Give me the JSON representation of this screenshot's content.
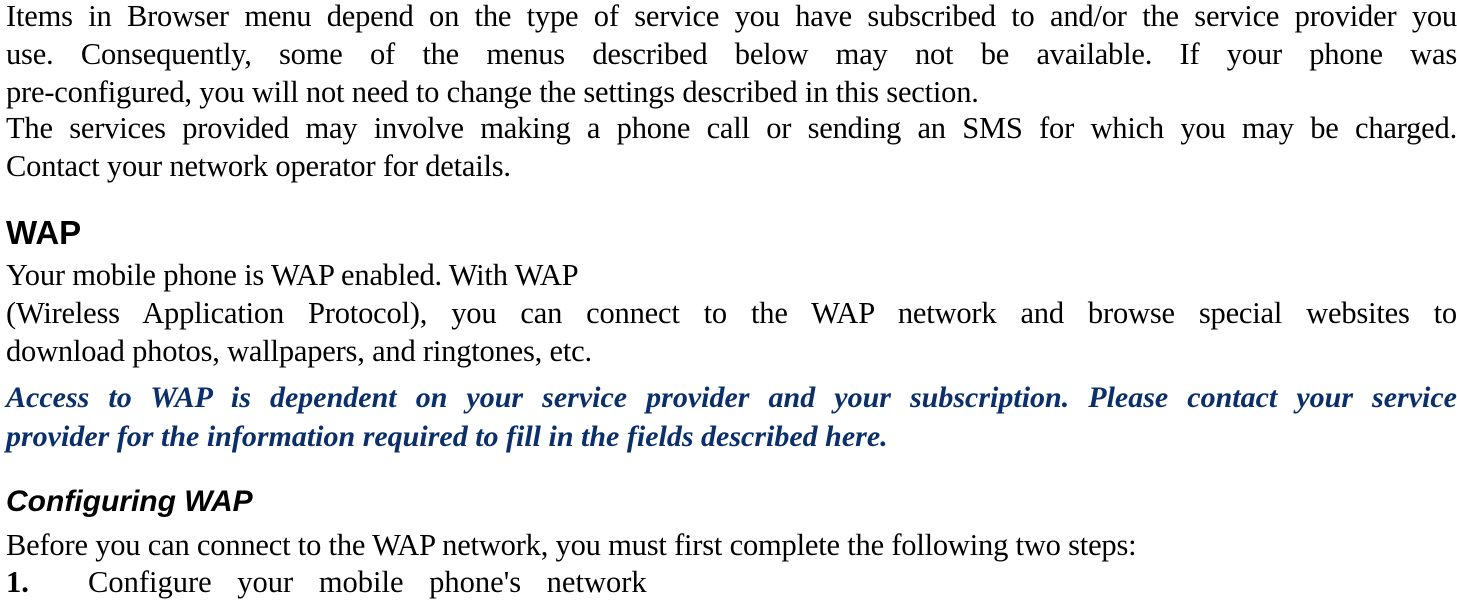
{
  "intro": {
    "lines": [
      "Items in Browser menu depend on the type of service you have subscribed to and/or the service provider you",
      "use. Consequently, some of the menus described below may not be available. If your phone was",
      "pre-configured, you will not need to change the settings described in this section."
    ],
    "charges_lines": [
      "The services provided may involve making a phone call or sending an SMS for which you may be charged.",
      "Contact your network operator for details."
    ]
  },
  "wap_section": {
    "heading": "WAP",
    "lines": [
      "Your mobile phone is WAP enabled. With WAP",
      "(Wireless Application Protocol), you can connect to the WAP network and browse special websites to",
      "download photos, wallpapers, and ringtones, etc."
    ],
    "note_lines": [
      "Access to WAP is dependent on your service provider and your subscription. Please contact your service",
      "provider for the information required to fill in the fields described here."
    ],
    "note_color": "#0b2f6b"
  },
  "configuring_section": {
    "heading": "Configuring WAP",
    "intro": "Before you can connect to the WAP network, you must first complete the following two steps:",
    "steps": [
      {
        "number": "1.",
        "text": "Configure your mobile phone's network"
      }
    ]
  }
}
